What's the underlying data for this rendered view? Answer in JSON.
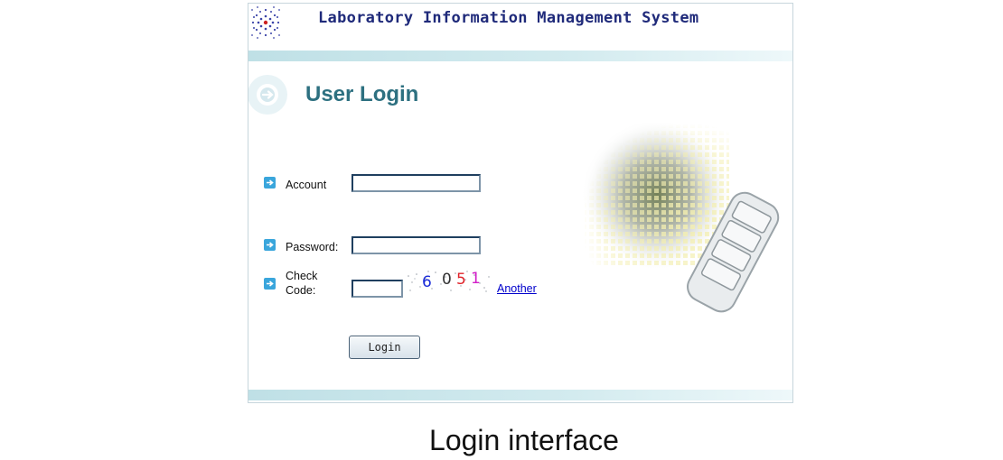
{
  "header": {
    "app_title": "Laboratory Information Management System",
    "logo_icon": "dotted-swirl-logo-icon"
  },
  "login": {
    "heading": "User Login",
    "heading_icon": "arrow-circle-icon",
    "fields": [
      {
        "label": "Account",
        "value": ""
      },
      {
        "label": "Password:",
        "value": ""
      }
    ],
    "check_code": {
      "label_line1": "Check",
      "label_line2": "Code:",
      "value": "",
      "captcha_digits": [
        "6",
        "0",
        "5",
        "1"
      ],
      "captcha_colors": [
        "#1a2bd8",
        "#333333",
        "#e0232a",
        "#d21ec8"
      ],
      "another_link": "Another"
    },
    "submit_label": "Login"
  },
  "caption": "Login interface",
  "colors": {
    "title": "#1f2a7a",
    "heading": "#2d7080",
    "band": "#bfe0e6",
    "bullet": "#3aa6dc"
  }
}
